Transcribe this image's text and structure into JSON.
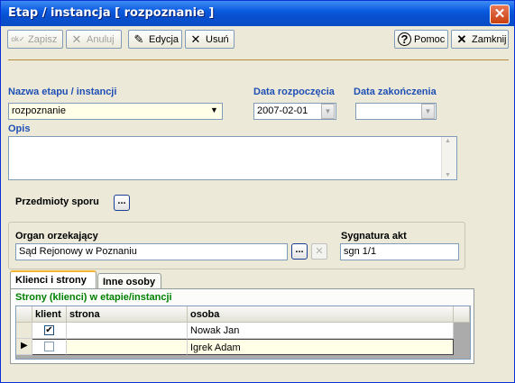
{
  "window": {
    "title": "Etap / instancja [ rozpoznanie ]",
    "close_glyph": "✕"
  },
  "toolbar": {
    "save_label": "Zapisz",
    "cancel_label": "Anuluj",
    "edit_label": "Edycja",
    "delete_label": "Usuń",
    "help_label": "Pomoc",
    "close_label": "Zamknij"
  },
  "form": {
    "stage_label": "Nazwa etapu / instancji",
    "stage_value": "rozpoznanie",
    "start_date_label": "Data rozpoczęcia",
    "start_date_value": "2007-02-01",
    "end_date_label": "Data zakończenia",
    "end_date_value": "",
    "description_label": "Opis",
    "description_value": "",
    "subjects_label": "Przedmioty sporu",
    "subjects_button": "...",
    "court_label": "Organ orzekający",
    "court_value": "Sąd Rejonowy w Poznaniu",
    "court_button": "...",
    "signature_label": "Sygnatura akt",
    "signature_value": "sgn 1/1"
  },
  "tabs": [
    {
      "label": "Klienci i strony"
    },
    {
      "label": "Inne osoby"
    }
  ],
  "parties": {
    "caption": "Strony (klienci) w etapie/instancji",
    "columns": [
      "klient",
      "strona",
      "osoba"
    ],
    "rows": [
      {
        "klient": true,
        "strona": "",
        "osoba": "Nowak Jan"
      },
      {
        "klient": false,
        "strona": "",
        "osoba": "Igrek Adam"
      }
    ]
  },
  "icons": {
    "ok": "ok-check-icon",
    "cancel": "x-icon",
    "edit": "edit-icon",
    "help": "help-icon",
    "close": "close-x-icon"
  },
  "colors": {
    "accent_label": "#1f4fb5",
    "caption_green": "#008000",
    "titlebar": "#0a5ae0"
  }
}
